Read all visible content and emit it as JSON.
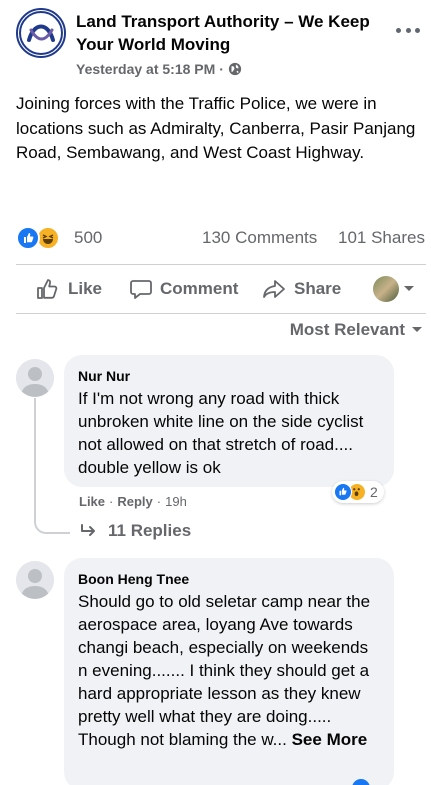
{
  "post": {
    "page_name": "Land Transport Authority – We Keep Your World Moving",
    "timestamp": "Yesterday at 5:18 PM",
    "separator": "·",
    "privacy_icon": "globe-icon",
    "text": "Joining forces with the Traffic Police, we were in locations such as Admiralty, Canberra, Pasir Panjang Road, Sembawang, and West Coast Highway."
  },
  "stats": {
    "reactions": "500",
    "comments": "130 Comments",
    "shares": "101 Shares",
    "reaction_icons": [
      "like-icon",
      "haha-icon"
    ]
  },
  "actions": {
    "like": "Like",
    "comment": "Comment",
    "share": "Share"
  },
  "sort_label": "Most Relevant",
  "comments": [
    {
      "author": "Nur Nur",
      "text": "If I'm not wrong any road with thick unbroken white line on the side cyclist not allowed on that stretch of road.... double yellow is ok",
      "like": "Like",
      "reply": "Reply",
      "age": "19h",
      "reaction_count": "2",
      "reaction_icons": [
        "like-icon",
        "wow-icon"
      ],
      "replies": "11 Replies"
    },
    {
      "author": "Boon Heng Tnee",
      "text": "Should go to old seletar camp near the aerospace area, loyang Ave towards changi beach, especially on weekends n evening....... I think they should get a hard appropriate lesson as they knew pretty well what they are doing..... Though not blaming the w...",
      "see_more": "See More"
    }
  ],
  "colors": {
    "fb_blue": "#1877f2",
    "text_secondary": "#65676b",
    "bubble_bg": "#f0f2f5",
    "haha_yellow": "#f7b125"
  }
}
